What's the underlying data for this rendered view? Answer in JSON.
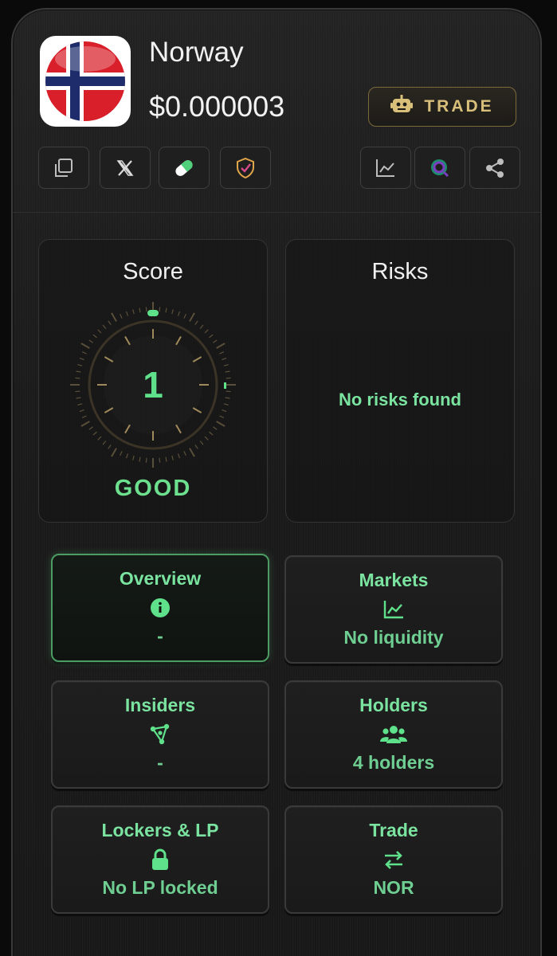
{
  "token": {
    "name": "Norway",
    "price": "$0.000003",
    "flag_icon": "norway-flag-icon"
  },
  "header": {
    "trade_label": "TRADE",
    "trade_icon": "robot-icon",
    "trade_color": "#d8bf7a",
    "left_actions": [
      {
        "name": "copy-button",
        "icon": "copy-icon"
      },
      {
        "name": "x-button",
        "icon": "x-logo-icon"
      },
      {
        "name": "pill-button",
        "icon": "pill-icon"
      },
      {
        "name": "audit-button",
        "icon": "shield-check-icon"
      }
    ],
    "right_actions": [
      {
        "name": "chart-button",
        "icon": "chart-icon"
      },
      {
        "name": "search-button",
        "icon": "magnify-icon"
      },
      {
        "name": "share-button",
        "icon": "share-icon"
      }
    ]
  },
  "score": {
    "title": "Score",
    "value": "1",
    "rating": "GOOD",
    "accent": "#5fe08a"
  },
  "risks": {
    "title": "Risks",
    "message": "No risks found"
  },
  "tiles": [
    {
      "label": "Overview",
      "icon": "info-icon",
      "value": "-",
      "active": true
    },
    {
      "label": "Markets",
      "icon": "chart-line-icon",
      "value": "No liquidity"
    },
    {
      "label": "Insiders",
      "icon": "network-icon",
      "value": "-"
    },
    {
      "label": "Holders",
      "icon": "users-icon",
      "value": "4 holders"
    },
    {
      "label": "Lockers & LP",
      "icon": "lock-icon",
      "value": "No LP locked"
    },
    {
      "label": "Trade",
      "icon": "swap-icon",
      "value": "NOR"
    }
  ]
}
